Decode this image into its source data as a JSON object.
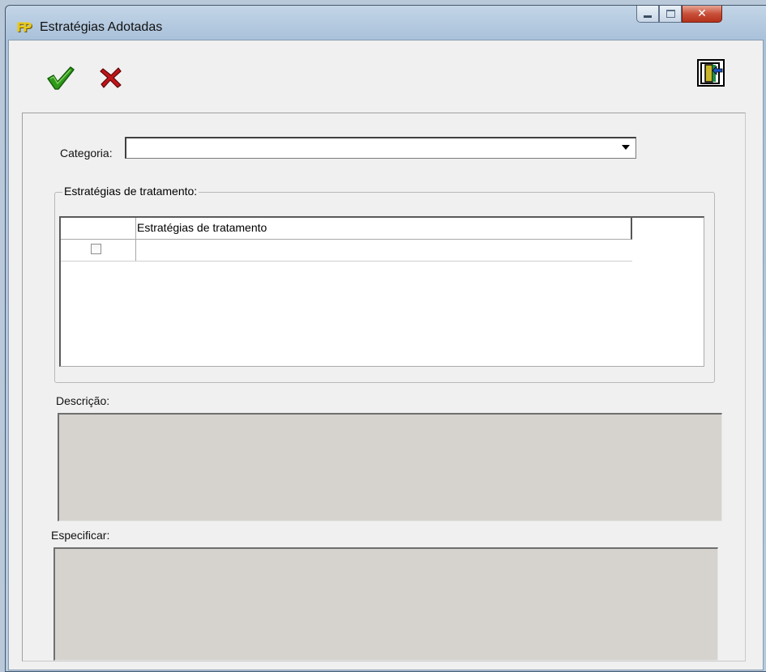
{
  "window": {
    "title": "Estratégias Adotadas",
    "controls": {
      "minimize": "minimize",
      "maximize": "maximize",
      "close": "x"
    }
  },
  "toolbar": {
    "confirm_icon": "checkmark-icon",
    "cancel_icon": "x-mark-icon",
    "exit_icon": "exit-door-icon"
  },
  "form": {
    "categoria_label": "Categoria:",
    "categoria_value": "",
    "group_label": "Estratégias de tratamento:",
    "grid": {
      "columns": [
        "",
        "Estratégias de tratamento"
      ],
      "rows": [
        {
          "checked": false,
          "estrategia": ""
        }
      ]
    },
    "descricao_label": "Descrição:",
    "descricao_value": "",
    "especificar_label": "Especificar:",
    "especificar_value": ""
  },
  "colors": {
    "check_green": "#2e9a1a",
    "cross_red": "#c0141a",
    "memo_gray": "#d6d3ce",
    "title_icon_yellow": "#e7c81b"
  }
}
